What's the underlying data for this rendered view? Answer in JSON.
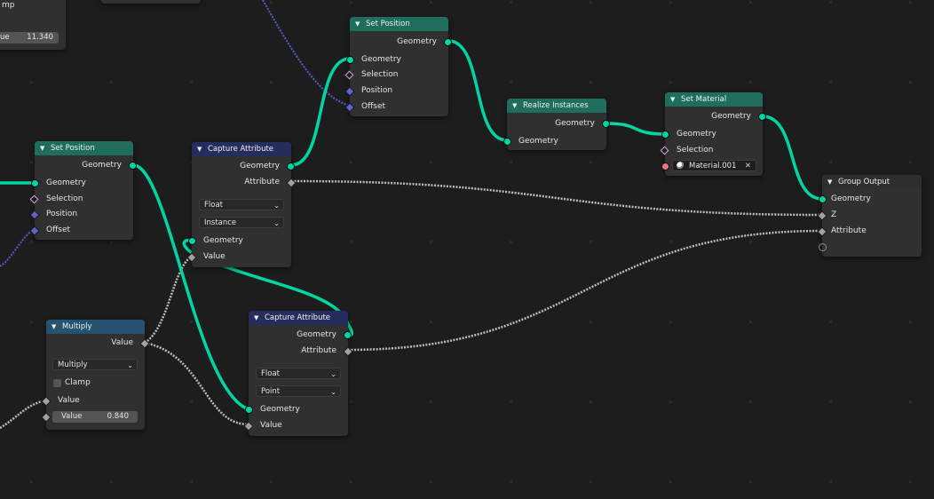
{
  "editor": "Geometry Node Editor",
  "colors": {
    "background": "#1d1d1d",
    "grid_dot": "#2a2a2a",
    "geometry_socket": "#00d6a3",
    "float_socket": "#a1a1a1",
    "vector_socket": "#6363c7",
    "boolean_socket": "#d3a7d3",
    "material_socket": "#eb7582",
    "geometry_header": "#1f6e5b",
    "attribute_header": "#252d5c",
    "math_header": "#24536f"
  },
  "partial_nodes": {
    "top_left": {
      "label_fragment": "mp",
      "field_key_fragment": "ue",
      "field_value": "11.340"
    }
  },
  "nodes": {
    "set_position_top": {
      "title": "Set Position",
      "outputs": [
        "Geometry"
      ],
      "inputs": [
        "Geometry",
        "Selection",
        "Position",
        "Offset"
      ]
    },
    "realize_instances": {
      "title": "Realize Instances",
      "outputs": [
        "Geometry"
      ],
      "inputs": [
        "Geometry"
      ]
    },
    "set_material": {
      "title": "Set Material",
      "outputs": [
        "Geometry"
      ],
      "inputs": [
        "Geometry",
        "Selection"
      ],
      "material": "Material.001"
    },
    "group_output": {
      "title": "Group Output",
      "inputs": [
        "Geometry",
        "Z",
        "Attribute",
        ""
      ]
    },
    "set_position_left": {
      "title": "Set Position",
      "outputs": [
        "Geometry"
      ],
      "inputs": [
        "Geometry",
        "Selection",
        "Position",
        "Offset"
      ]
    },
    "capture_attribute_1": {
      "title": "Capture Attribute",
      "outputs": [
        "Geometry",
        "Attribute"
      ],
      "data_type": "Float",
      "domain": "Instance",
      "inputs": [
        "Geometry",
        "Value"
      ]
    },
    "capture_attribute_2": {
      "title": "Capture Attribute",
      "outputs": [
        "Geometry",
        "Attribute"
      ],
      "data_type": "Float",
      "domain": "Point",
      "inputs": [
        "Geometry",
        "Value"
      ]
    },
    "multiply": {
      "title": "Multiply",
      "outputs": [
        "Value"
      ],
      "operation": "Multiply",
      "clamp_label": "Clamp",
      "clamp": false,
      "inputs": [
        "Value"
      ],
      "value_field": {
        "label": "Value",
        "value": "0.840"
      }
    }
  }
}
